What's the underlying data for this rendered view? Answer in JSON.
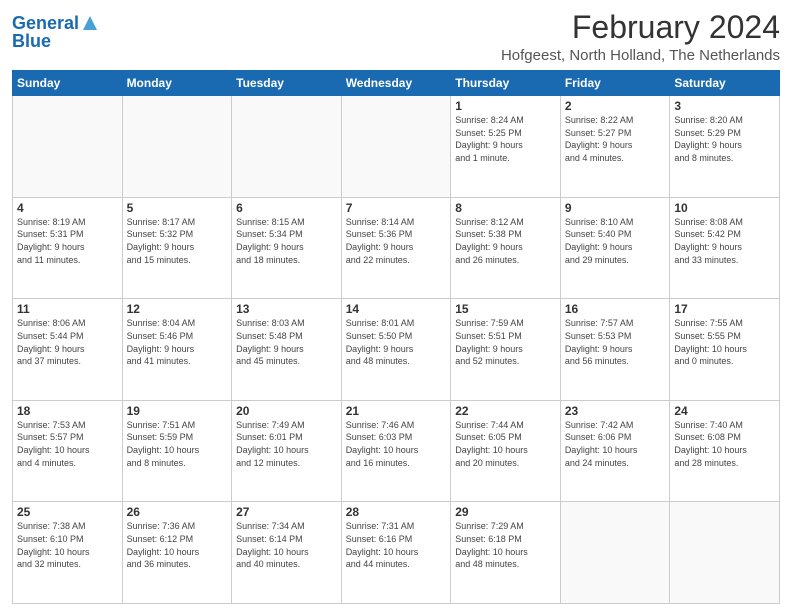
{
  "header": {
    "logo_line1": "General",
    "logo_line2": "Blue",
    "month": "February 2024",
    "location": "Hofgeest, North Holland, The Netherlands"
  },
  "days_of_week": [
    "Sunday",
    "Monday",
    "Tuesday",
    "Wednesday",
    "Thursday",
    "Friday",
    "Saturday"
  ],
  "weeks": [
    [
      {
        "day": "",
        "info": ""
      },
      {
        "day": "",
        "info": ""
      },
      {
        "day": "",
        "info": ""
      },
      {
        "day": "",
        "info": ""
      },
      {
        "day": "1",
        "info": "Sunrise: 8:24 AM\nSunset: 5:25 PM\nDaylight: 9 hours\nand 1 minute."
      },
      {
        "day": "2",
        "info": "Sunrise: 8:22 AM\nSunset: 5:27 PM\nDaylight: 9 hours\nand 4 minutes."
      },
      {
        "day": "3",
        "info": "Sunrise: 8:20 AM\nSunset: 5:29 PM\nDaylight: 9 hours\nand 8 minutes."
      }
    ],
    [
      {
        "day": "4",
        "info": "Sunrise: 8:19 AM\nSunset: 5:31 PM\nDaylight: 9 hours\nand 11 minutes."
      },
      {
        "day": "5",
        "info": "Sunrise: 8:17 AM\nSunset: 5:32 PM\nDaylight: 9 hours\nand 15 minutes."
      },
      {
        "day": "6",
        "info": "Sunrise: 8:15 AM\nSunset: 5:34 PM\nDaylight: 9 hours\nand 18 minutes."
      },
      {
        "day": "7",
        "info": "Sunrise: 8:14 AM\nSunset: 5:36 PM\nDaylight: 9 hours\nand 22 minutes."
      },
      {
        "day": "8",
        "info": "Sunrise: 8:12 AM\nSunset: 5:38 PM\nDaylight: 9 hours\nand 26 minutes."
      },
      {
        "day": "9",
        "info": "Sunrise: 8:10 AM\nSunset: 5:40 PM\nDaylight: 9 hours\nand 29 minutes."
      },
      {
        "day": "10",
        "info": "Sunrise: 8:08 AM\nSunset: 5:42 PM\nDaylight: 9 hours\nand 33 minutes."
      }
    ],
    [
      {
        "day": "11",
        "info": "Sunrise: 8:06 AM\nSunset: 5:44 PM\nDaylight: 9 hours\nand 37 minutes."
      },
      {
        "day": "12",
        "info": "Sunrise: 8:04 AM\nSunset: 5:46 PM\nDaylight: 9 hours\nand 41 minutes."
      },
      {
        "day": "13",
        "info": "Sunrise: 8:03 AM\nSunset: 5:48 PM\nDaylight: 9 hours\nand 45 minutes."
      },
      {
        "day": "14",
        "info": "Sunrise: 8:01 AM\nSunset: 5:50 PM\nDaylight: 9 hours\nand 48 minutes."
      },
      {
        "day": "15",
        "info": "Sunrise: 7:59 AM\nSunset: 5:51 PM\nDaylight: 9 hours\nand 52 minutes."
      },
      {
        "day": "16",
        "info": "Sunrise: 7:57 AM\nSunset: 5:53 PM\nDaylight: 9 hours\nand 56 minutes."
      },
      {
        "day": "17",
        "info": "Sunrise: 7:55 AM\nSunset: 5:55 PM\nDaylight: 10 hours\nand 0 minutes."
      }
    ],
    [
      {
        "day": "18",
        "info": "Sunrise: 7:53 AM\nSunset: 5:57 PM\nDaylight: 10 hours\nand 4 minutes."
      },
      {
        "day": "19",
        "info": "Sunrise: 7:51 AM\nSunset: 5:59 PM\nDaylight: 10 hours\nand 8 minutes."
      },
      {
        "day": "20",
        "info": "Sunrise: 7:49 AM\nSunset: 6:01 PM\nDaylight: 10 hours\nand 12 minutes."
      },
      {
        "day": "21",
        "info": "Sunrise: 7:46 AM\nSunset: 6:03 PM\nDaylight: 10 hours\nand 16 minutes."
      },
      {
        "day": "22",
        "info": "Sunrise: 7:44 AM\nSunset: 6:05 PM\nDaylight: 10 hours\nand 20 minutes."
      },
      {
        "day": "23",
        "info": "Sunrise: 7:42 AM\nSunset: 6:06 PM\nDaylight: 10 hours\nand 24 minutes."
      },
      {
        "day": "24",
        "info": "Sunrise: 7:40 AM\nSunset: 6:08 PM\nDaylight: 10 hours\nand 28 minutes."
      }
    ],
    [
      {
        "day": "25",
        "info": "Sunrise: 7:38 AM\nSunset: 6:10 PM\nDaylight: 10 hours\nand 32 minutes."
      },
      {
        "day": "26",
        "info": "Sunrise: 7:36 AM\nSunset: 6:12 PM\nDaylight: 10 hours\nand 36 minutes."
      },
      {
        "day": "27",
        "info": "Sunrise: 7:34 AM\nSunset: 6:14 PM\nDaylight: 10 hours\nand 40 minutes."
      },
      {
        "day": "28",
        "info": "Sunrise: 7:31 AM\nSunset: 6:16 PM\nDaylight: 10 hours\nand 44 minutes."
      },
      {
        "day": "29",
        "info": "Sunrise: 7:29 AM\nSunset: 6:18 PM\nDaylight: 10 hours\nand 48 minutes."
      },
      {
        "day": "",
        "info": ""
      },
      {
        "day": "",
        "info": ""
      }
    ]
  ]
}
